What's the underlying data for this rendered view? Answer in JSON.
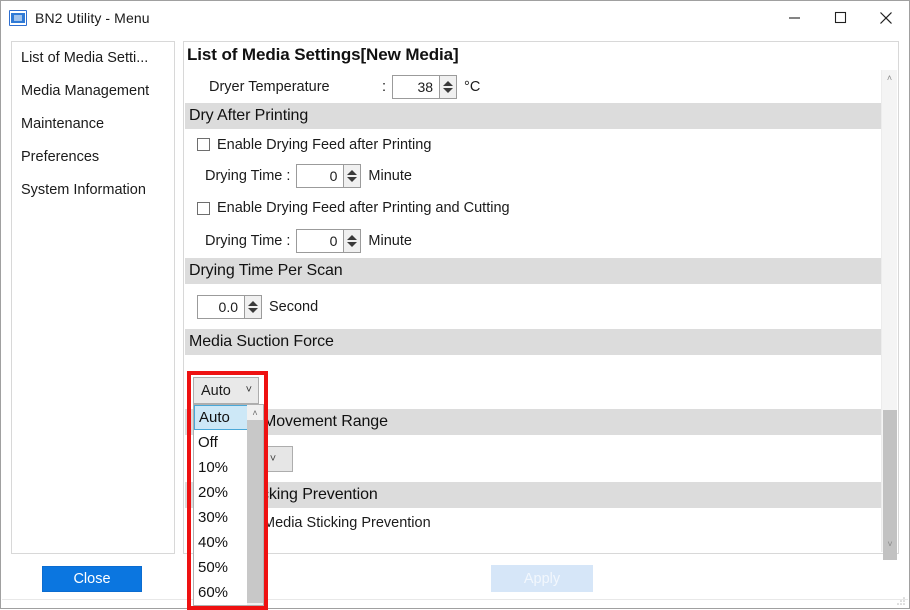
{
  "window": {
    "title": "BN2 Utility - Menu",
    "icon": "app-icon",
    "minimize_label": "—",
    "maximize_label": "□",
    "close_label": "✕"
  },
  "sidebar": {
    "items": [
      {
        "label": "List of Media Setti..."
      },
      {
        "label": "Media Management"
      },
      {
        "label": "Maintenance"
      },
      {
        "label": "Preferences"
      },
      {
        "label": "System Information"
      }
    ]
  },
  "content": {
    "title": "List of Media Settings[New Media]",
    "rows": [
      {
        "type": "field",
        "label": "Dryer Temperature",
        "colon": ":",
        "value": "38",
        "unit": "°C"
      },
      {
        "type": "section",
        "label": "Dry After Printing"
      },
      {
        "type": "checkbox",
        "label": "Enable Drying Feed after Printing",
        "checked": false
      },
      {
        "type": "field",
        "label": "Drying Time :",
        "value": "0",
        "unit": "Minute"
      },
      {
        "type": "checkbox",
        "label": "Enable Drying Feed after Printing and Cutting",
        "checked": false
      },
      {
        "type": "field",
        "label": "Drying Time :",
        "value": "0",
        "unit": "Minute"
      },
      {
        "type": "section",
        "label": "Drying Time Per Scan"
      },
      {
        "type": "field",
        "label": "",
        "value": "0.0",
        "unit": "Second"
      },
      {
        "type": "section",
        "label": "Media Suction Force"
      },
      {
        "type": "section",
        "label": "Movement Range"
      },
      {
        "type": "minicombo",
        "label": ""
      },
      {
        "type": "section",
        "label": "cking Prevention"
      },
      {
        "type": "checkbox",
        "label": "Media Sticking Prevention",
        "checked": false
      }
    ]
  },
  "suction_combo": {
    "name": "media-suction-force-combobox",
    "selected": "Auto",
    "chevron": "˅",
    "options": [
      "Auto",
      "Off",
      "10%",
      "20%",
      "30%",
      "40%",
      "50%",
      "60%"
    ],
    "highlighted": "Auto"
  },
  "head_movement_combo": {
    "chevron": "˅"
  },
  "scrollbar": {
    "up_arrow": "˄",
    "down_arrow": "˅"
  },
  "dropdown_scrollbar": {
    "up_arrow": "˄"
  },
  "footer": {
    "close_label": "Close",
    "apply_label": "Apply",
    "apply_disabled": true
  },
  "annotation": {
    "highlight_color": "#ee1111"
  }
}
